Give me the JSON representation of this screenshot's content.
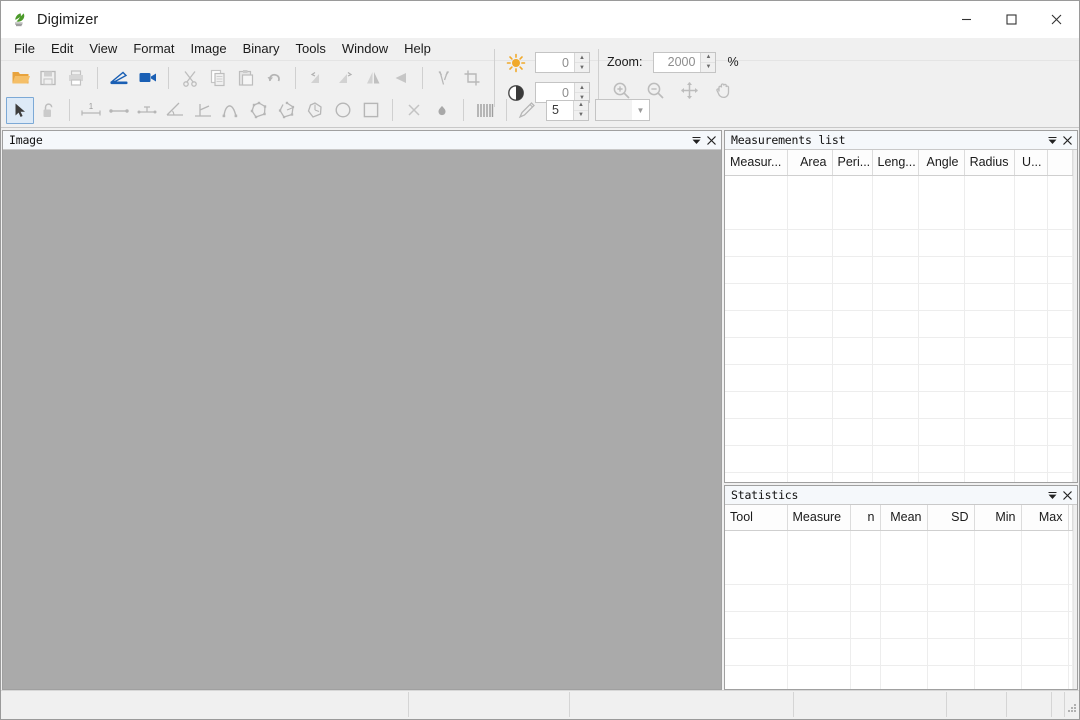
{
  "window": {
    "title": "Digimizer",
    "app_icon": "leaf-icon",
    "controls": [
      {
        "name": "minimize-button",
        "glyph": "minimize-icon"
      },
      {
        "name": "maximize-button",
        "glyph": "maximize-icon"
      },
      {
        "name": "close-button",
        "glyph": "close-icon"
      }
    ]
  },
  "menubar": {
    "items": [
      {
        "label": "File"
      },
      {
        "label": "Edit"
      },
      {
        "label": "View"
      },
      {
        "label": "Format"
      },
      {
        "label": "Image"
      },
      {
        "label": "Binary"
      },
      {
        "label": "Tools"
      },
      {
        "label": "Window"
      },
      {
        "label": "Help"
      }
    ]
  },
  "toolbar_row1": {
    "buttons": [
      {
        "name": "open-file-icon",
        "enabled": true
      },
      {
        "name": "save-icon",
        "enabled": false
      },
      {
        "name": "print-icon",
        "enabled": false
      },
      {
        "name": "scanner-icon",
        "enabled": true
      },
      {
        "name": "video-camera-icon",
        "enabled": true
      },
      {
        "name": "cut-icon",
        "enabled": false
      },
      {
        "name": "copy-icon",
        "enabled": false
      },
      {
        "name": "paste-icon",
        "enabled": false
      },
      {
        "name": "undo-icon",
        "enabled": false
      },
      {
        "name": "rotate-left-icon",
        "enabled": false
      },
      {
        "name": "rotate-right-icon",
        "enabled": false
      },
      {
        "name": "flip-horizontal-icon",
        "enabled": false
      },
      {
        "name": "flip-vertical-icon",
        "enabled": false
      },
      {
        "name": "calibrate-icon",
        "enabled": false
      },
      {
        "name": "crop-icon",
        "enabled": false
      }
    ]
  },
  "toolbar_row2": {
    "buttons": [
      {
        "name": "select-arrow-tool",
        "active": true
      },
      {
        "name": "lock-icon",
        "active": false
      },
      {
        "name": "measure-distance-tool",
        "active": false
      },
      {
        "name": "line-tool",
        "active": false
      },
      {
        "name": "perpendicular-distance-tool",
        "active": false
      },
      {
        "name": "angle-tool",
        "active": false
      },
      {
        "name": "angle-perpendicular-tool",
        "active": false
      },
      {
        "name": "curve-tool",
        "active": false
      },
      {
        "name": "polygon-tool",
        "active": false
      },
      {
        "name": "closed-polygon-tool",
        "active": false
      },
      {
        "name": "freehand-area-tool",
        "active": false
      },
      {
        "name": "circle-tool",
        "active": false
      },
      {
        "name": "rectangle-tool",
        "active": false
      },
      {
        "name": "delete-object-icon",
        "active": false
      },
      {
        "name": "point-tool",
        "active": false
      },
      {
        "name": "grid-ruler-icon",
        "active": false
      }
    ]
  },
  "pen": {
    "icon": "pencil-icon",
    "width_value": "5",
    "color_label": ""
  },
  "image_adjust": {
    "brightness": {
      "icon": "brightness-sun-icon",
      "value": "0"
    },
    "contrast": {
      "icon": "contrast-circle-icon",
      "value": "0"
    }
  },
  "zoom_controls": {
    "label": "Zoom:",
    "value": "2000",
    "suffix": "%",
    "buttons": [
      {
        "name": "zoom-in-icon"
      },
      {
        "name": "zoom-out-icon"
      },
      {
        "name": "pan-move-icon"
      },
      {
        "name": "hand-grab-icon"
      }
    ]
  },
  "image_panel": {
    "title": "Image",
    "dropdown_icon": "chevron-down-icon",
    "close_icon": "close-icon",
    "canvas_color": "#aaaaaa"
  },
  "measurements_panel": {
    "title": "Measurements list",
    "dropdown_icon": "chevron-down-icon",
    "close_icon": "close-icon",
    "columns": [
      "Measur...",
      "Area",
      "Peri...",
      "Leng...",
      "Angle",
      "Radius",
      "U..."
    ],
    "rows": []
  },
  "statistics_panel": {
    "title": "Statistics",
    "dropdown_icon": "chevron-down-icon",
    "close_icon": "close-icon",
    "columns": [
      "Tool",
      "Measure",
      "n",
      "Mean",
      "SD",
      "Min",
      "Max"
    ],
    "rows": []
  },
  "statusbar": {
    "cells": [
      "",
      "",
      "",
      "",
      "",
      "",
      ""
    ],
    "grip_icon": "resize-grip-icon"
  },
  "colors": {
    "accent_blue": "#1a5fb4",
    "folder_orange": "#e8a33d",
    "canvas_gray": "#aaaaaa",
    "chrome_gray": "#f0f0f0"
  }
}
